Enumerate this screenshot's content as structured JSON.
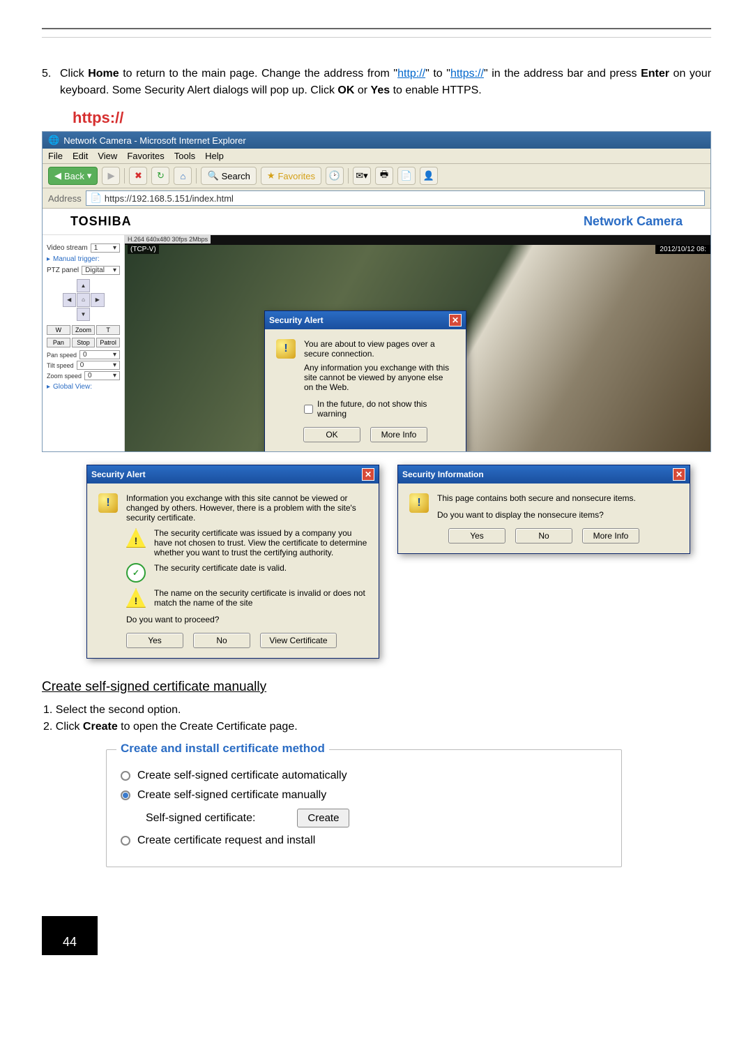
{
  "step5": {
    "num": "5.",
    "pre": "Click ",
    "home": "Home",
    "mid1": " to return to the main page. Change the address from \"",
    "http": "http://",
    "mid2": "\" to \"",
    "https": "https://",
    "mid3": "\" in the address bar and press ",
    "enter": "Enter",
    "mid4": " on your keyboard. Some Security Alert dialogs will pop up. Click ",
    "ok": "OK",
    "or": " or ",
    "yes": "Yes",
    "end": " to enable HTTPS."
  },
  "httpsLabel": "https://",
  "browser": {
    "title": "Network Camera - Microsoft Internet Explorer",
    "menu": {
      "file": "File",
      "edit": "Edit",
      "view": "View",
      "favorites": "Favorites",
      "tools": "Tools",
      "help": "Help"
    },
    "back": "Back",
    "search": "Search",
    "favoritesBtn": "Favorites",
    "addressLabel": "Address",
    "url": "https://192.168.5.151/index.html"
  },
  "camera": {
    "brand": "TOSHIBA",
    "title": "Network Camera",
    "streamLabel": "Video stream",
    "streamVal": "1",
    "manualTrigger": "Manual trigger:",
    "ptzLabel": "PTZ panel",
    "ptzVal": "Digital",
    "btnRow1": {
      "w": "W",
      "zoom": "Zoom",
      "t": "T"
    },
    "btnRow2": {
      "pan": "Pan",
      "stop": "Stop",
      "patrol": "Patrol"
    },
    "panSpeed": "Pan speed",
    "tiltSpeed": "Tilt speed",
    "zoomSpeed": "Zoom speed",
    "speedVal": "0",
    "globalView": "Global View:",
    "streamInfo": "H.264  640x480  30fps  2Mbps",
    "tcpv": "(TCP-V)",
    "timestamp": "2012/10/12 08:"
  },
  "alert1": {
    "title": "Security Alert",
    "line1": "You are about to view pages over a secure connection.",
    "line2": "Any information you exchange with this site cannot be viewed by anyone else on the Web.",
    "checkbox": "In the future, do not show this warning",
    "ok": "OK",
    "moreInfo": "More Info"
  },
  "alert2": {
    "title": "Security Alert",
    "p1": "Information you exchange with this site cannot be viewed or changed by others. However, there is a problem with the site's security certificate.",
    "p2": "The security certificate was issued by a company you have not chosen to trust. View the certificate to determine whether you want to trust the certifying authority.",
    "p3": "The security certificate date is valid.",
    "p4": "The name on the security certificate is invalid or does not match the name of the site",
    "proceed": "Do you want to proceed?",
    "yes": "Yes",
    "no": "No",
    "view": "View Certificate"
  },
  "alert3": {
    "title": "Security Information",
    "p1": "This page contains both secure and nonsecure items.",
    "p2": "Do you want to display the nonsecure items?",
    "yes": "Yes",
    "no": "No",
    "moreInfo": "More Info"
  },
  "section": {
    "heading": "Create self-signed certificate manually",
    "s1": "1. Select the second option.",
    "s2a": "2. Click ",
    "s2b": "Create",
    "s2c": " to open the Create Certificate page."
  },
  "cert": {
    "legend": "Create and install certificate method",
    "opt1": "Create self-signed certificate automatically",
    "opt2": "Create self-signed certificate manually",
    "subLabel": "Self-signed certificate:",
    "createBtn": "Create",
    "opt3": "Create certificate request and install"
  },
  "pageNum": "44"
}
